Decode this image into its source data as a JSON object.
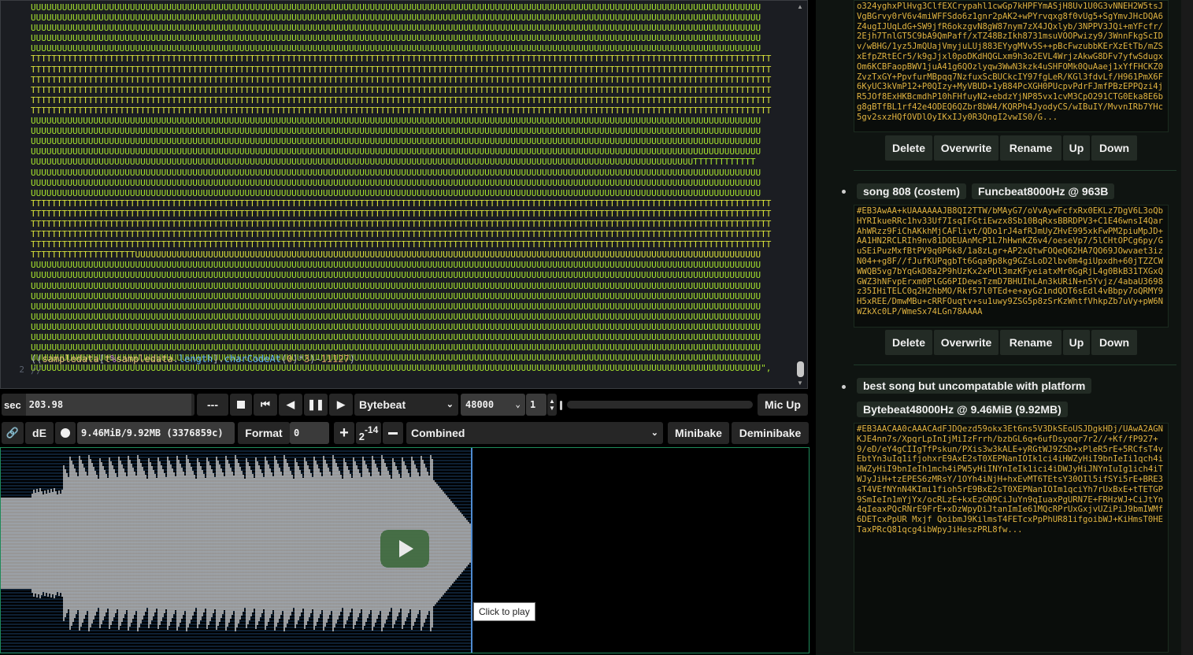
{
  "editor": {
    "line_numbers": [
      "2"
    ],
    "code_rows": [
      {
        "type": "U",
        "text": "UUUUUUUUUUUUUUUUUUUUUUUUUUUUUUUUUUUUUUUUUUUUUUUUUUUUUUUUUUUUUUUUUUUUUUUUUUUUUUUUUUUUUUUUUUUUUUUUUUUUUUUUUUUUUUUUUUUUUUUUUUUUUUUUUUUUUUUUUUUU"
      },
      {
        "type": "U",
        "text": "UUUUUUUUUUUUUUUUUUUUUUUUUUUUUUUUUUUUUUUUUUUUUUUUUUUUUUUUUUUUUUUUUUUUUUUUUUUUUUUUUUUUUUUUUUUUUUUUUUUUUUUUUUUUUUUUUUUUUUUUUUUUUUUUUUUUUUUUUUUU"
      },
      {
        "type": "U",
        "text": "UUUUUUUUUUUUUUUUUUUUUUUUUUUUUUUUUUUUUUUUUUUUUUUUUUUUUUUUUUUUUUUUUUUUUUUUUUUUUUUUUUUUUUUUUUUUUUUUUUUUUUUUUUUUUUUUUUUUUUUUUUUUUUUUUUUUUUUUUUUU"
      },
      {
        "type": "U",
        "text": "UUUUUUUUUUUUUUUUUUUUUUUUUUUUUUUUUUUUUUUUUUUUUUUUUUUUUUUUUUUUUUUUUUUUUUUUUUUUUUUUUUUUUUUUUUUUUUUUUUUUUUUUUUUUUUUUUUUUUUUUUUUUUUUUUUUUUUUUUUUU"
      },
      {
        "type": "U",
        "text": "UUUUUUUUUUUUUUUUUUUUUUUUUUUUUUUUUUUUUUUUUUUUUUUUUUUUUUUUUUUUUUUUUUUUUUUUUUUUUUUUUUUUUUUUUUUUUUUUUUUUUUUUUUUUUUUUUUUUUUUUUUUUUUUUUUUUUUUUUUUU"
      },
      {
        "type": "T",
        "text": "TTTTTTTTTTTTTTTTTTTTTTTTTTTTTTTTTTTTTTTTTTTTTTTTTTTTTTTTTTTTTTTTTTTTTTTTTTTTTTTTTTTTTTTTTTTTTTTTTTTTTTTTTTTTTTTTTTTTTTTTTTTTTTTTTTTTTTTTTTTTTT"
      },
      {
        "type": "T",
        "text": "TTTTTTTTTTTTTTTTTTTTTTTTTTTTTTTTTTTTTTTTTTTTTTTTTTTTTTTTTTTTTTTTTTTTTTTTTTTTTTTTTTTTTTTTTTTTTTTTTTTTTTTTTTTTTTTTTTTTTTTTTTTTTTTTTTTTTTTTTTTTTT"
      },
      {
        "type": "T",
        "text": "TTTTTTTTTTTTTTTTTTTTTTTTTTTTTTTTTTTTTTTTTTTTTTTTTTTTTTTTTTTTTTTTTTTTTTTTTTTTTTTTTTTTTTTTTTTTTTTTTTTTTTTTTTTTTTTTTTTTTTTTTTTTTTTTTTTTTTTTTTTTTT"
      },
      {
        "type": "T",
        "text": "TTTTTTTTTTTTTTTTTTTTTTTTTTTTTTTTTTTTTTTTTTTTTTTTTTTTTTTTTTTTTTTTTTTTTTTTTTTTTTTTTTTTTTTTTTTTTTTTTTTTTTTTTTTTTTTTTTTTTTTTTTTTTTTTTTTTTTTTTTTTTT"
      },
      {
        "type": "T",
        "text": "TTTTTTTTTTTTTTTTTTTTTTTTTTTTTTTTTTTTTTTTTTTTTTTTTTTTTTTTTTTTTTTTTTTTTTTTTTTTTTTTTTTTTTTTTTTTTTTTTTTTTTTTTTTTTTTTTTTTTTTTTTTTTTTTTTTTTTTTTTTTTT"
      },
      {
        "type": "T",
        "text": "TTTTTTTTTTTTTTTTTTTTTTTTTTTTTTTTTTTTTTTTTTTTTTTTTTTTTTTTTTTTTTTTTTTTTTTTTTTTTTTTTTTTTTTTTTTTTTTTTTTTTTTTTTTTTTTTTTTTTTTTTTTTTTTTTTTTTTTTTTTTTT"
      },
      {
        "type": "U",
        "text": "UUUUUUUUUUUUUUUUUUUUUUUUUUUUUUUUUUUUUUUUUUUUUUUUUUUUUUUUUUUUUUUUUUUUUUUUUUUUUUUUUUUUUUUUUUUUUUUUUUUUUUUUUUUUUUUUUUUUUUUUUUUUUUUUUUUUUUUUUUUU"
      },
      {
        "type": "U",
        "text": "UUUUUUUUUUUUUUUUUUUUUUUUUUUUUUUUUUUUUUUUUUUUUUUUUUUUUUUUUUUUUUUUUUUUUUUUUUUUUUUUUUUUUUUUUUUUUUUUUUUUUUUUUUUUUUUUUUUUUUUUUUUUUUUUUUUUUUUUUUUU"
      },
      {
        "type": "U",
        "text": "UUUUUUUUUUUUUUUUUUUUUUUUUUUUUUUUUUUUUUUUUUUUUUUUUUUUUUUUUUUUUUUUUUUUUUUUUUUUUUUUUUUUUUUUUUUUUUUUUUUUUUUUUUUUUUUUUUUUUUUUUUUUUUUUUUUUUUUUUUUU"
      },
      {
        "type": "U",
        "text": "UUUUUUUUUUUUUUUUUUUUUUUUUUUUUUUUUUUUUUUUUUUUUUUUUUUUUUUUUUUUUUUUUUUUUUUUUUUUUUUUUUUUUUUUUUUUUUUUUUUUUUUUUUUUUUUUUUUUUUUUUUUUUUUUUUUUUUUUUUUU"
      },
      {
        "type": "U",
        "text": "UUUUUUUUUUUUUUUUUUUUUUUUUUUUUUUUUUUUUUUUUUUUUUUUUUUUUUUUUUUUUUUUUUUUUUUUUUUUUUUUUUUUUUUUUUUUUUUUUUUUUUUUUUUUUUUUUUUUUUUUUUUUUUUTTTTTTTTTTTT"
      },
      {
        "type": "U",
        "text": "UUUUUUUUUUUUUUUUUUUUUUUUUUUUUUUUUUUUUUUUUUUUUUUUUUUUUUUUUUUUUUUUUUUUUUUUUUUUUUUUUUUUUUUUUUUUUUUUUUUUUUUUUUUUUUUUUUUUUUUUUUUUUUUUUUUUUUUUUUUU"
      },
      {
        "type": "U",
        "text": "UUUUUUUUUUUUUUUUUUUUUUUUUUUUUUUUUUUUUUUUUUUUUUUUUUUUUUUUUUUUUUUUUUUUUUUUUUUUUUUUUUUUUUUUUUUUUUUUUUUUUUUUUUUUUUUUUUUUUUUUUUUUUUUUUUUUUUUUUUUU"
      },
      {
        "type": "U",
        "text": "UUUUUUUUUUUUUUUUUUUUUUUUUUUUUUUUUUUUUUUUUUUUUUUUUUUUUUUUUUUUUUUUUUUUUUUUUUUUUUUUUUUUUUUUUUUUUUUUUUUUUUUUUUUUUUUUUUUUUUUUUUUUUUUUUUUUUUUUUUUU"
      },
      {
        "type": "T",
        "text": "TTTTTTTTTTTTTTTTTTTTTTTTTTTTTTTTTTTTTTTTTTTTTTTTTTTTTTTTTTTTTTTTTTTTTTTTTTTTTTTTTTTTTTTTTTTTTTTTTTTTTTTTTTTTTTTTTTTTTTTTTTTTTTTTTTTTTTTTTTTTTT"
      },
      {
        "type": "T",
        "text": "TTTTTTTTTTTTTTTTTTTTTTTTTTTTTTTTTTTTTTTTTTTTTTTTTTTTTTTTTTTTTTTTTTTTTTTTTTTTTTTTTTTTTTTTTTTTTTTTTTTTTTTTTTTTTTTTTTTTTTTTTTTTTTTTTTTTTTTTTTTTTT"
      },
      {
        "type": "T",
        "text": "TTTTTTTTTTTTTTTTTTTTTTTTTTTTTTTTTTTTTTTTTTTTTTTTTTTTTTTTTTTTTTTTTTTTTTTTTTTTTTTTTTTTTTTTTTTTTTTTTTTTTTTTTTTTTTTTTTTTTTTTTTTTTTTTTTTTTTTTTTTTTT"
      },
      {
        "type": "T",
        "text": "TTTTTTTTTTTTTTTTTTTTTTTTTTTTTTTTTTTTTTTTTTTTTTTTTTTTTTTTTTTTTTTTTTTTTTTTTTTTTTTTTTTTTTTTTTTTTTTTTTTTTTTTTTTTTTTTTTTTTTTTTTTTTTTTTTTTTTTTTTTTTT"
      },
      {
        "type": "T",
        "text": "TTTTTTTTTTTTTTTTTTTTTTTTTTTTTTTTTTTTTTTTTTTTTTTTTTTTTTTTTTTTTTTTTTTTTTTTTTTTTTTTTTTTTTTTTTTTTTTTTTTTTTTTTTTTTTTTTTTTTTTTTTTTTTTTTTTTTTTTTTTTTT"
      },
      {
        "type": "T",
        "text": "TTTTTTTTTTTTTTTTTTTTUUUUUUUUUUUUUUUUUUUUUUUUUUUUUUUUUUUUUUUUUUUUUUUUUUUUUUUUUUUUUUUUUUUUUUUUUUUUUUUUUUUUUUUUUUUUUUUUUUUUUUUUUUUUUUUUUUUUUUUU"
      },
      {
        "type": "U",
        "text": "UUUUUUUUUUUUUUUUUUUUUUUUUUUUUUUUUUUUUUUUUUUUUUUUUUUUUUUUUUUUUUUUUUUUUUUUUUUUUUUUUUUUUUUUUUUUUUUUUUUUUUUUUUUUUUUUUUUUUUUUUUUUUUUUUUUUUUUUUUUU"
      },
      {
        "type": "U",
        "text": "UUUUUUUUUUUUUUUUUUUUUUUUUUUUUUUUUUUUUUUUUUUUUUUUUUUUUUUUUUUUUUUUUUUUUUUUUUUUUUUUUUUUUUUUUUUUUUUUUUUUUUUUUUUUUUUUUUUUUUUUUUUUUUUUUUUUUUUUUUUU"
      },
      {
        "type": "U",
        "text": "UUUUUUUUUUUUUUUUUUUUUUUUUUUUUUUUUUUUUUUUUUUUUUUUUUUUUUUUUUUUUUUUUUUUUUUUUUUUUUUUUUUUUUUUUUUUUUUUUUUUUUUUUUUUUUUUUUUUUUUUUUUUUUUUUUUUUUUUUUUU"
      },
      {
        "type": "U",
        "text": "UUUUUUUUUUUUUUUUUUUUUUUUUUUUUUUUUUUUUUUUUUUUUUUUUUUUUUUUUUUUUUUUUUUUUUUUUUUUUUUUUUUUUUUUUUUUUUUUUUUUUUUUUUUUUUUUUUUUUUUUUUUUUUUUUUUUUUUUUUUU"
      },
      {
        "type": "U",
        "text": "UUUUUUUUUUUUUUUUUUUUUUUUUUUUUUUUUUUUUUUUUUUUUUUUUUUUUUUUUUUUUUUUUUUUUUUUUUUUUUUUUUUUUUUUUUUUUUUUUUUUUUUUUUUUUUUUUUUUUUUUUUUUUUUUUUUUUUUUUUUU"
      },
      {
        "type": "U",
        "text": "UUUUUUUUUUUUUUUUUUUUUUUUUUUUUUUUUUUUUUUUUUUUUUUUUUUUUUUUUUUUUUUUUUUUUUUUUUUUUUUUUUUUUUUUUUUUUUUUUUUUUUUUUUUUUUUUUUUUUUUUUUUUUUUUUUUUUUUUUUUU"
      },
      {
        "type": "U",
        "text": "UUUUUUUUUUUUUUUUUUUUUUUUUUUUUUUUUUUUUUUUUUUUUUUUUUUUUUUUUUUUUUUUUUUUUUUUUUUUUUUUUUUUUUUUUUUUUUUUUUUUUUUUUUUUUUUUUUUUUUUUUUUUUUUUUUUUUUUUUUUU"
      },
      {
        "type": "U",
        "text": "UUUUUUUUUUUUUUUUUUUUUUUUUUUUUUUUUUUUUUUUUUUUUUUUUUUUUUUUUUUUUUUUUUUUUUUUUUUUUUUUUUUUUUUUUUUUUUUUUUUUUUUUUUUUUUUUUUUUUUUUUUUUUUUUUUUUUUUUUUUU"
      },
      {
        "type": "U",
        "text": "UUUUUUUUUUUUUUUUUUUUUUUUUUUUUUUUUUUUUUUUUUUUUUUUUUUUUUUUUUUUUUUUUUUUUUUUUUUUUUUUUUUUUUUUUUUUUUUUUUUUUUUUUUUUUUUUUUUUUUUUUUUUUUUUUUUUUUUUUUUU"
      },
      {
        "type": "U",
        "text": "UUUUUUUUUUUUUUUUUUUUUUUUUUUUUUUUUUUUUUUUUUUUUUUUUUUUUUUUUUUUUUUUUUUUUUUUUUUUUUUUUUUUUUUUUUUUUUUUUUUUUUUUUUUUUUUUUUUUUUUUUUUUUUUUUUUUUUUUUUUU"
      },
      {
        "type": "U",
        "text": "UUUUUUUUUUUUUUUUUUUUUUUUUUUUUUUUUUUUUUUUUUUUUUUUUUUUUUUUUUUUUUUUUUUUUUUUUUUUUUUUUUUUUUUUUUUUUUUUUUUUUUUUUUUUUUUUUUUUUUUUUUUUUUUUUUUUUUUUUUUU\","
      }
    ],
    "expr_parts": {
      "a": "((",
      "b": "sampledata",
      "c": "[",
      "d": "t",
      "e": "%",
      "f": "sampledata",
      "g": ".",
      "h": "length",
      "i": "].",
      "j": "charCodeAt",
      "k": "(",
      "l": "0",
      "m": ")*",
      "n": "3",
      "o": ")-",
      "p": "11127",
      "q": ")"
    },
    "comment": "//"
  },
  "toolbar1": {
    "sec_label": "sec",
    "sec_value": "203.98",
    "dash_label": "---",
    "mode": "Bytebeat",
    "samplerate": "48000",
    "divisor": "1",
    "mic_label": "Mic Up"
  },
  "toolbar2": {
    "de_label": "dE",
    "size_text": "9.46MiB/9.92MB (3376859c)",
    "format_label": "Format",
    "format_value": "0",
    "pow_base": "2",
    "pow_exp": "-14",
    "view_mode": "Combined",
    "minibake_label": "Minibake",
    "deminibake_label": "Deminibake"
  },
  "waveform": {
    "tooltip": "Click to play"
  },
  "library": {
    "entry1": {
      "code": "o324yghxPlHvg3ClfEXCrypahl1cwGp7kHPFYmASjH8Uv1U0G3vNNEH2W5tsJVgBGrvy0rV6v4miWFFSdo6z1gnr2pAK2+wPYrvqxg8f0vUg5+SgYmvJHcDQA6Z4ugIJUqLdG+SW9jfR6okzgvN8gW87nym7zX4JQxlyb/3NPPV3JQi+mYFcfr/2Ejh7TnlGT5C9bA9QmPaff/xTZ48BzIkh8731msuVOOPwizy9/3WnnFkgScIDv/wBHG/1yz5JmQUajVmyjuLUj883EYygMVv5S++pBcFwzubbKErXzEtTb/mZSxEfpZRtECr5/k9gJjxl0poDKdHQGLxm9h3o2EVL4WrjzAkwG8DFv7yfwSdugxOm6KCBFaopBWV1juA41g6QOzlyqw3WwN3kzk4uSHFOMk0QuAaej1xYfFHCKZ0ZvzTxGY+PpvfurMBpqq7NzfuxScBUCkcIY97fgLeR/KGl3fdvLf/H961PmX6F6KyUC3kVmP12+P0QIzy+MyVBUD+1yB84PcXGH0PUcpvPdrFJmfPBzEPPQzi4jR5JOf8ExHKBcmdhP10hFHfuyN2+ebdzYjNP85vx1cvM3CpO291CTG0Eka8E6bg8gBTfBL1rf42e4ODEQ6QZbr8bW4/KQRPh4JyodyCS/wIBuIY/MvvnIRb7YHc5gv2sxzHQfOVDlOyIKxIJy0R3QngI2vwIS0/G..."
    },
    "entry2": {
      "title": "song 808 (costem)",
      "tag": "Funcbeat8000Hz @ 963B",
      "code": "#EB3AwAA+kUAAAAAAJB8QI2TTW/bMAyG7/oVvAywFcfxRx0EKLz7DgV6L3oQbHYRIkueRRc1hv33Uf7IsqIFGtiEwzx8Sb10BqRxsBBRDPV3+C1E46wnsI4QarAhWRzz9FiChAKkhMjCAFlivt/QDo1rJ4afRJmUyZHvE995xkFwPM2piuMpJD+AA1HN2RCLRIh9nv81DOEUAnMcP1L7hHwnKZ6v4/oeseVp7/5lCHtOPCg6py/GuSEiPuzMxfBtPV9q0P6k8/1a8zLgr+AP2xQtwFOQeQ62HA7QO69JOwvaet3izN04++g8F//fJufKUPqgbTt6Gqa9p8kg9GZsLoD2lbv0m4giUpxdh+60jTZZCWWWQB5vg7bYqGkD8a2P9hUzKx2xPUl3mzKFyeiatxMr0GgRjL4g0BkB31TXGxQGWZ3hNFvpErxm0PlGG6PIDewsTzmD7BHUIhLAn3kURiN+n5Yvjz/4abaU3698z35IHiTELC0q2H2hbMO/Rkf57l0TEd+e+ayGz1ndQOT6sEdl4vBbpy7oQRMY9H5xREE/DmwMBu+cRRFOuqtv+su1uwy9ZSG5p8zSrKzWhtfVhkpZb7uVy+pW6NWZkXc0LP/WmeSx74LGn78AAAA"
    },
    "entry3": {
      "title": "best song but uncompatable with platform",
      "tag": "Bytebeat48000Hz @ 9.46MiB (9.92MB)",
      "code": "#EB3AACAA0cAAACAdFJDQezd59okx3Et6ns5V3DkSEoUSJDgkHDj/UAwA2AGNKJE4nn7s/XpqrLpInIjMiIzFrrh/bzbGL6q+6ufDsyoqr7r2//+Kf/fP927+9/eD/eY4gCIIgTfPskun/PXis3w3kALE+yRGtWJ9ZSD+xPleR5rE+5RCfsT4vEbtYn3uIq1ifjohxrE9AxE2sT0XEPNanIOIk1ci4iHWZyHiI9bnIeIi1qch4iHWZyHiI9bnIeIh1mch4iPW5yHiINYnIeIk1ici4iDWJyHiJNYnIuIg1ich4iTWJyJiH+tzEPES6zMRsY/1OYh4iNjH+hxEvMT6TEtsY30OIl5ifSYi5rE+BRE3sT4VEfNYnN4KImi1fioh5rE9BxE2sT0XEPNanIOIm1qciYh7rUxBxE+tTETGP9SmIeIn1mYjYx/ocRLzE+kxEzGN9CiJuYn9qIuaxPgURN7E+FRHzWJ+CiJtYn4qIeaxPQcRNrE9FrE+xDzWpyDiJtanImIe61MQcRPrUxGxjvUZiPiJ9bmIWMf6DETcxPpUR Mxjf QoibmJ9KilmsT4FETcxPpPhUR81ifgoibWJ+KiHmsT0HETaxPRcQ81qcg4ibWpyJiHeszPRL8fw..."
    },
    "buttons": {
      "delete": "Delete",
      "overwrite": "Overwrite",
      "rename": "Rename",
      "up": "Up",
      "down": "Down"
    }
  },
  "colors": {
    "code_u": "#a6e22e",
    "code_t": "#d7e03a",
    "library_code": "#e0b340",
    "accent_border": "#1e8a5a"
  }
}
